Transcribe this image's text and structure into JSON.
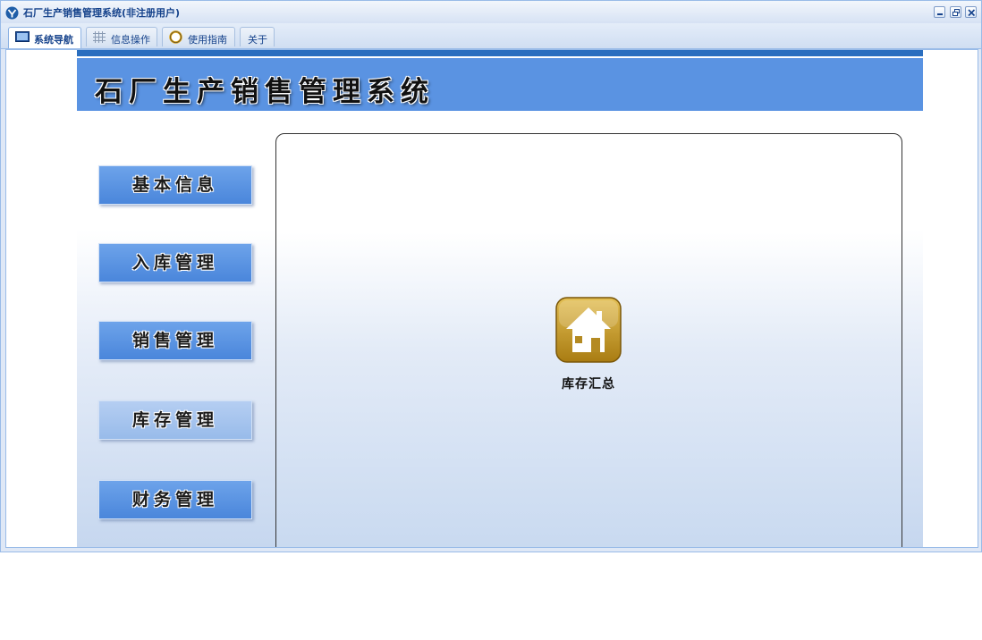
{
  "window": {
    "title": "石厂生产销售管理系统(非注册用户)"
  },
  "tabs": [
    {
      "label": "系统导航",
      "icon": "monitor-icon",
      "active": true
    },
    {
      "label": "信息操作",
      "icon": "grid-icon",
      "active": false
    },
    {
      "label": "使用指南",
      "icon": "help-ring-icon",
      "active": false
    },
    {
      "label": "关于",
      "icon": "",
      "active": false
    }
  ],
  "banner": {
    "title": "石厂生产销售管理系统"
  },
  "nav": [
    {
      "label": "基本信息",
      "selected": false
    },
    {
      "label": "入库管理",
      "selected": false
    },
    {
      "label": "销售管理",
      "selected": false
    },
    {
      "label": "库存管理",
      "selected": true
    },
    {
      "label": "财务管理",
      "selected": false
    }
  ],
  "content": {
    "items": [
      {
        "label": "库存汇总",
        "icon": "home-icon"
      }
    ]
  },
  "colors": {
    "banner": "#5a93e2",
    "banner_stripe": "#2a6ebf",
    "nav_button": "#5a93e2",
    "nav_button_selected": "#a5c4ee",
    "home_icon": "#c19524",
    "title_text": "#15428b"
  }
}
